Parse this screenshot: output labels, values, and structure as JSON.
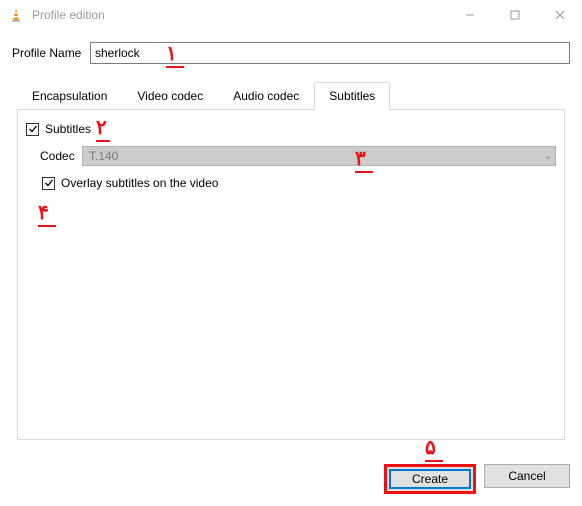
{
  "window": {
    "title": "Profile edition"
  },
  "profile": {
    "label": "Profile Name",
    "value": "sherlock"
  },
  "tabs": {
    "encapsulation": "Encapsulation",
    "video": "Video codec",
    "audio": "Audio codec",
    "subtitles": "Subtitles"
  },
  "subtitlesTab": {
    "enableLabel": "Subtitles",
    "codecLabel": "Codec",
    "codecValue": "T.140",
    "overlayLabel": "Overlay subtitles on the video"
  },
  "buttons": {
    "create": "Create",
    "cancel": "Cancel"
  },
  "annotations": {
    "a1": "۱",
    "a2": "۲",
    "a3": "۳",
    "a4": "۴",
    "a5": "۵"
  }
}
